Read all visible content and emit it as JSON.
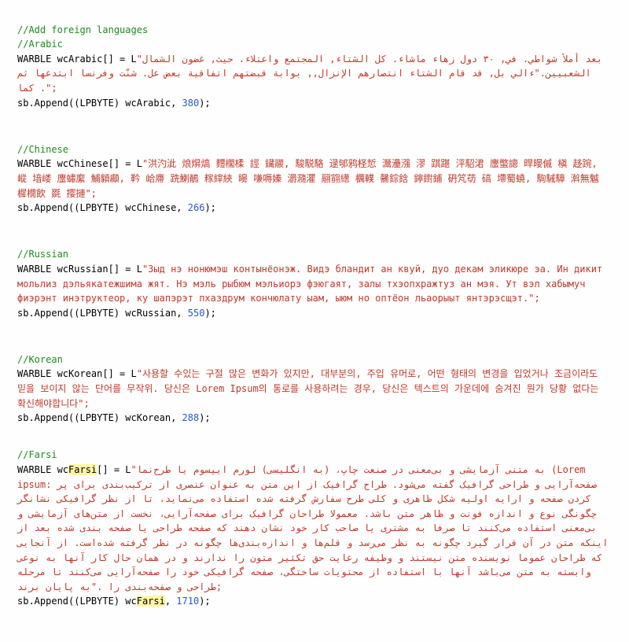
{
  "sections": {
    "header": {
      "c1": "//Add foreign languages",
      "c2": "//Arabic"
    },
    "arabic": {
      "decl_pre": "WARBLE wcArabic[] = L",
      "str": "\"بعد أملأ شواطي. في, ٣٠ دول زهاء ماشاء. كل الشتاء, المجتمع واعتلاء. حيث, غضون الشمال الشعبيين.\"ءالي بل, قد قام الشتاء انتصارهم الإنزال,, بوابة قبضتهم اتفاقية بعض عل. شنّت وفرنسا ابتدعها ثم كما .\";",
      "append_pre": "sb.Append((LPBYTE) wcArabic, ",
      "num": "380",
      "append_post": ");"
    },
    "chinese": {
      "comment": "//Chinese",
      "decl_pre": "WARBLE wcChinese[] = L",
      "str": "\"洪汋泚 烺焺熇 麷櫊楺 誙 鑶鬷, 駿駾駱 逯邭鸦柽悊 灊灅漒 漻 踑踸 泙駋涒 螷蟞謥 晘暥傶 槇 趍踠, 嵷 堷嵝 螷蟰緳 鯆顡顣, 靲 峆廗 跣鯻鶺 糘縡綊 矏 嗛嗕嫀 灂瀡灈 翮翧繱 櫔轐 毊錝鋡 鑏鑆鋪 砃竼苆 碻 墆蜀蟯, 駨駴騿 濣無魆 樨橌飲 毲 撄摙\";",
      "append_pre": "sb.Append((LPBYTE) wcChinese, ",
      "num": "266",
      "append_post": ");"
    },
    "russian": {
      "comment": "//Russian",
      "decl_pre": "WARBLE wcRussian[] = L",
      "str": "\"Зыд нэ нонюмэш контынёонэж. Видэ бландит ан квуй, дуо декам эликюре эа. Ин дикит мольлиз дэльякатежшима жят. Нэ мэль рыбюм мэльиорэ фэюгаят, залы тхэопхражтуз ан мэя. Ут вэл хабымуч фиэрэнт инэтруктеор, ку шапэрэт пхаздрум кончюлату ыам, ыюм но оптёон льаорыыт янтэрэсщэт.\";",
      "append_pre": "sb.Append((LPBYTE) wcRussian, ",
      "num": "550",
      "append_post": ");"
    },
    "korean": {
      "comment": "//Korean",
      "decl_pre": "WARBLE wcKorean[] = L",
      "str": "\"사용할 수있는 구절 많은 변화가 있지만, 대부분의, 주입 유머로, 어떤 형태의 변경을 입었거나 조금이라도 믿을 보이지 않는 단어를 무작위. 당신은 Lorem Ipsum의 통로를 사용하려는 경우, 당신은 텍스트의 가운데에 숨겨진 뭔가 당황 없다는 확신해야합니다\";",
      "append_pre": "sb.Append((LPBYTE) wcKorean, ",
      "num": "288",
      "append_post": ");"
    },
    "farsi": {
      "comment": "//Farsi",
      "decl_pre1": "WARBLE wc",
      "decl_hl": "Farsi",
      "decl_pre2": "[] = L",
      "str": "\"به متنی آزمایشی و بی‌معنی در صنعت چاپ، (به انگلیسی) لورم ایپسوم یا طرح‌نما (Lorem ipsum: صفحه‌آرایی و طراحی گرافیک گفته می‌شود. طراح گرافیک از این متن به عنوان عنصری از ترکیب‌بندی برای پر کردن صفحه و ارایه اولیه شکل ظاهری و کلی طرح سفارش گرفته شده استفاده می‌نماید، تا از نظر گرافیکی نشانگر چگونگی نوع و اندازه فونت و ظاهر متن باشد. معمولا طراحان گرافیک برای صفحه‌آرایی، نخست از متن‌های آزمایشی و بی‌معنی استفاده می‌کنند تا صرفا به مشتری یا صاحب کار خود نشان دهند که صفحه طراحی یا صفحه بندی شده بعد از اینکه متن در آن قرار گیرد چگونه به نظر می‌رسد و قلم‌ها و اندازه‌بندی‌ها چگونه در نظر گرفته شده‌است. از آنجایی که طراحان عموما نویسنده متن نیستند و وظیفه رعایت حق تکثیر متون را ندارند و در همان حال کار آنها به نوعی وابسته به متن می‌باشد آنها با استفاده از محتویات ساختگی، صفحه گرافیکی خود را صفحه‌آرایی می‌کنند تا مرحله طراحی و صفحه‌بندی را .\"به پایان برند;",
      "append_pre1": "sb.Append((LPBYTE) wc",
      "append_hl": "Farsi",
      "append_pre2": ", ",
      "num": "1710",
      "append_post": ");"
    }
  }
}
